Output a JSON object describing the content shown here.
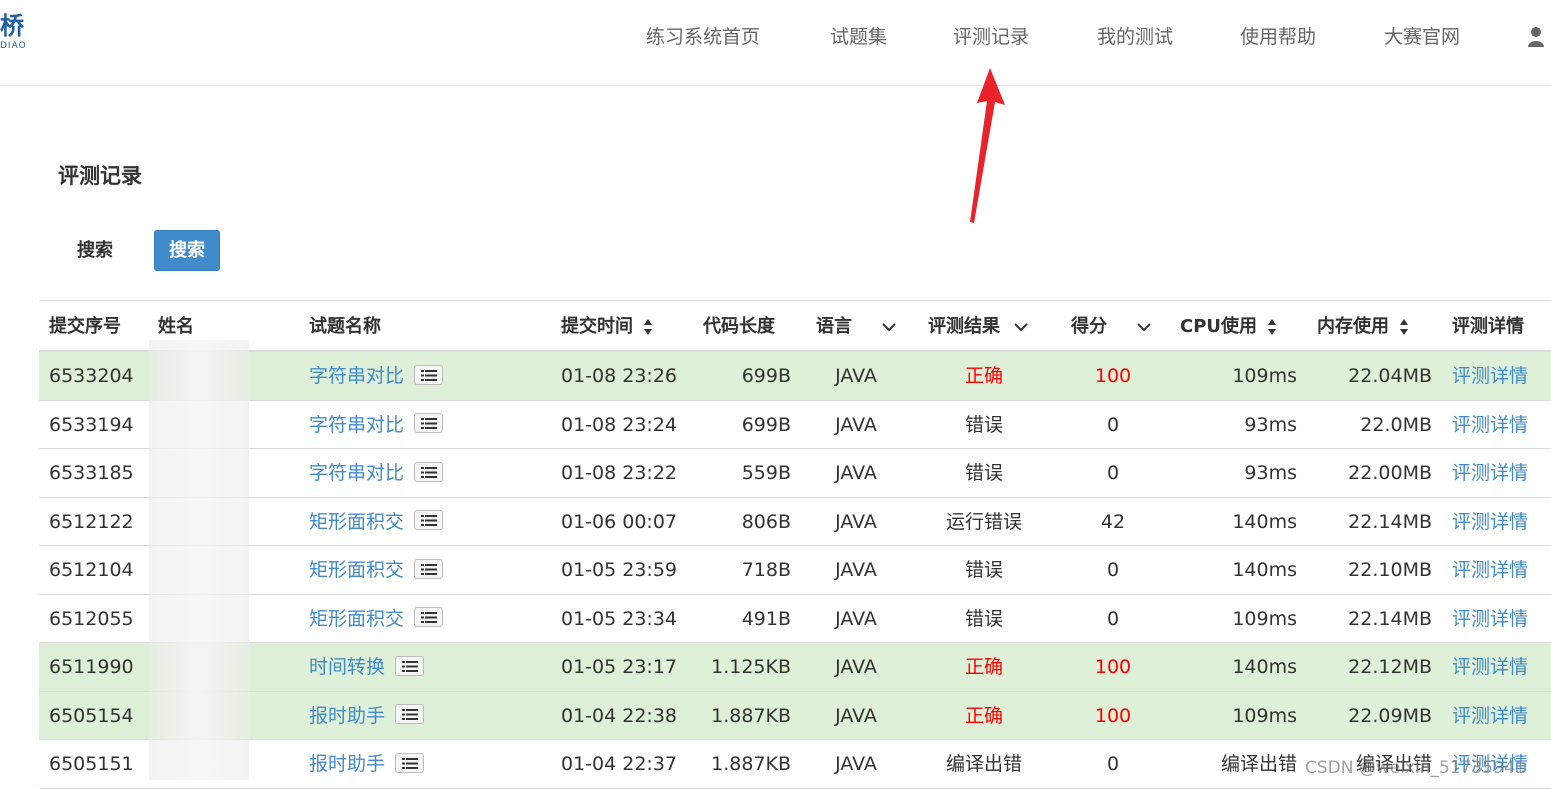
{
  "logo": {
    "main": "桥",
    "sub": "DIAO"
  },
  "nav": {
    "items": [
      {
        "label": "练习系统首页"
      },
      {
        "label": "试题集"
      },
      {
        "label": "评测记录"
      },
      {
        "label": "我的测试"
      },
      {
        "label": "使用帮助"
      },
      {
        "label": "大赛官网"
      }
    ]
  },
  "page": {
    "title": "评测记录",
    "search_label": "搜索",
    "search_button": "搜索"
  },
  "table": {
    "headers": {
      "id": "提交序号",
      "name": "姓名",
      "problem": "试题名称",
      "time": "提交时间",
      "length": "代码长度",
      "lang": "语言",
      "result": "评测结果",
      "score": "得分",
      "cpu": "CPU使用",
      "mem": "内存使用",
      "detail": "评测详情"
    },
    "rows": [
      {
        "id": "6533204",
        "problem": "字符串对比",
        "time": "01-08 23:26",
        "length": "699B",
        "lang": "JAVA",
        "result": "正确",
        "score": "100",
        "cpu": "109ms",
        "mem": "22.04MB",
        "detail": "评测详情",
        "correct": true
      },
      {
        "id": "6533194",
        "problem": "字符串对比",
        "time": "01-08 23:24",
        "length": "699B",
        "lang": "JAVA",
        "result": "错误",
        "score": "0",
        "cpu": "93ms",
        "mem": "22.0MB",
        "detail": "评测详情",
        "correct": false
      },
      {
        "id": "6533185",
        "problem": "字符串对比",
        "time": "01-08 23:22",
        "length": "559B",
        "lang": "JAVA",
        "result": "错误",
        "score": "0",
        "cpu": "93ms",
        "mem": "22.00MB",
        "detail": "评测详情",
        "correct": false
      },
      {
        "id": "6512122",
        "problem": "矩形面积交",
        "time": "01-06 00:07",
        "length": "806B",
        "lang": "JAVA",
        "result": "运行错误",
        "score": "42",
        "cpu": "140ms",
        "mem": "22.14MB",
        "detail": "评测详情",
        "correct": false
      },
      {
        "id": "6512104",
        "problem": "矩形面积交",
        "time": "01-05 23:59",
        "length": "718B",
        "lang": "JAVA",
        "result": "错误",
        "score": "0",
        "cpu": "140ms",
        "mem": "22.10MB",
        "detail": "评测详情",
        "correct": false
      },
      {
        "id": "6512055",
        "problem": "矩形面积交",
        "time": "01-05 23:34",
        "length": "491B",
        "lang": "JAVA",
        "result": "错误",
        "score": "0",
        "cpu": "109ms",
        "mem": "22.14MB",
        "detail": "评测详情",
        "correct": false
      },
      {
        "id": "6511990",
        "problem": "时间转换",
        "time": "01-05 23:17",
        "length": "1.125KB",
        "lang": "JAVA",
        "result": "正确",
        "score": "100",
        "cpu": "140ms",
        "mem": "22.12MB",
        "detail": "评测详情",
        "correct": true
      },
      {
        "id": "6505154",
        "problem": "报时助手",
        "time": "01-04 22:38",
        "length": "1.887KB",
        "lang": "JAVA",
        "result": "正确",
        "score": "100",
        "cpu": "109ms",
        "mem": "22.09MB",
        "detail": "评测详情",
        "correct": true
      },
      {
        "id": "6505151",
        "problem": "报时助手",
        "time": "01-04 22:37",
        "length": "1.887KB",
        "lang": "JAVA",
        "result": "编译出错",
        "score": "0",
        "cpu": "编译出错",
        "mem": "编译出错",
        "detail": "评测详情",
        "correct": false
      }
    ]
  },
  "watermark": "CSDN @weixin_51735941",
  "colors": {
    "accent": "#428bca",
    "correct_row": "#dff0d8",
    "correct_text": "#ff0000",
    "arrow": "#e8232a"
  },
  "icons": {
    "user": "user-icon",
    "list": "list-icon",
    "sort": "sort-icon",
    "chevron": "chevron-down-icon"
  }
}
